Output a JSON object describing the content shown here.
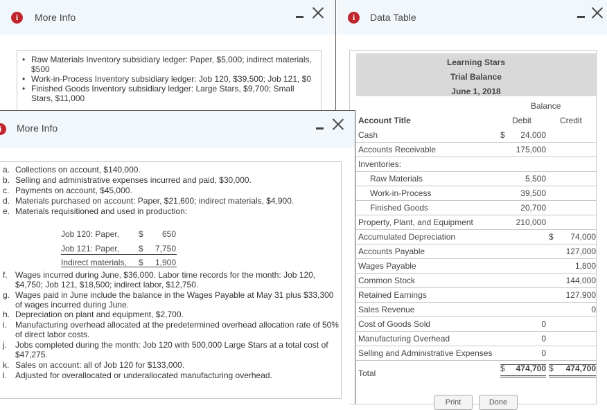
{
  "more_info_1": {
    "title": "More Info",
    "bullets": [
      "Raw Materials Inventory subsidiary ledger: Paper, $5,000; indirect materials, $500",
      "Work-in-Process Inventory subsidiary ledger: Job 120, $39,500; Job 121, $0",
      "Finished Goods Inventory subsidiary ledger: Large Stars, $9,700; Small Stars, $11,000"
    ]
  },
  "more_info_2": {
    "title": "More Info",
    "items": [
      {
        "letter": "a.",
        "text": "Collections on account, $140,000."
      },
      {
        "letter": "b.",
        "text": "Selling and administrative expenses incurred and paid, $30,000."
      },
      {
        "letter": "c.",
        "text": "Payments on account, $45,000."
      },
      {
        "letter": "d.",
        "text": "Materials purchased on account: Paper, $21,600; indirect materials, $4,900."
      },
      {
        "letter": "e.",
        "text": "Materials requisitioned and used in production:"
      },
      {
        "letter": "f.",
        "text": "Wages incurred during June, $36,000. Labor time records for the month: Job 120, $4,750; Job 121, $18,500; indirect labor, $12,750."
      },
      {
        "letter": "g.",
        "text": "Wages paid in June include the balance in the Wages Payable at May 31 plus $33,300 of wages incurred during June."
      },
      {
        "letter": "h.",
        "text": "Depreciation on plant and equipment, $2,700."
      },
      {
        "letter": "i.",
        "text": "Manufacturing overhead allocated at the predetermined overhead allocation rate of 50% of direct labor costs."
      },
      {
        "letter": "j.",
        "text": "Jobs completed during the month: Job 120 with 500,000 Large Stars at a total cost of $47,275."
      },
      {
        "letter": "k.",
        "text": "Sales on account: all of Job 120 for $133,000."
      },
      {
        "letter": "l.",
        "text": "Adjusted for overallocated or underallocated manufacturing overhead."
      }
    ],
    "requisitions": [
      {
        "label": "Job 120: Paper,",
        "dollar": "$",
        "amount": "650"
      },
      {
        "label": "Job 121: Paper,",
        "dollar": "$",
        "amount": "7,750"
      },
      {
        "label": "Indirect materials,",
        "dollar": "$",
        "amount": "1,900"
      }
    ]
  },
  "data_table": {
    "title": "Data Table",
    "company": "Learning Stars",
    "report": "Trial Balance",
    "date": "June 1, 2018",
    "balance_header": "Balance",
    "col_account": "Account Title",
    "col_debit": "Debit",
    "col_credit": "Credit",
    "rows": [
      {
        "account": "Cash",
        "debit_sign": "$",
        "debit": "24,000",
        "credit_sign": "",
        "credit": ""
      },
      {
        "account": "Accounts Receivable",
        "debit_sign": "",
        "debit": "175,000",
        "credit_sign": "",
        "credit": ""
      },
      {
        "account": "Inventories:",
        "debit_sign": "",
        "debit": "",
        "credit_sign": "",
        "credit": ""
      },
      {
        "account": "Raw Materials",
        "indent": true,
        "debit_sign": "",
        "debit": "5,500",
        "credit_sign": "",
        "credit": ""
      },
      {
        "account": "Work-in-Process",
        "indent": true,
        "debit_sign": "",
        "debit": "39,500",
        "credit_sign": "",
        "credit": ""
      },
      {
        "account": "Finished Goods",
        "indent": true,
        "debit_sign": "",
        "debit": "20,700",
        "credit_sign": "",
        "credit": ""
      },
      {
        "account": "Property, Plant, and Equipment",
        "debit_sign": "",
        "debit": "210,000",
        "credit_sign": "",
        "credit": ""
      },
      {
        "account": "Accumulated Depreciation",
        "debit_sign": "",
        "debit": "",
        "credit_sign": "$",
        "credit": "74,000"
      },
      {
        "account": "Accounts Payable",
        "debit_sign": "",
        "debit": "",
        "credit_sign": "",
        "credit": "127,000"
      },
      {
        "account": "Wages Payable",
        "debit_sign": "",
        "debit": "",
        "credit_sign": "",
        "credit": "1,800"
      },
      {
        "account": "Common Stock",
        "debit_sign": "",
        "debit": "",
        "credit_sign": "",
        "credit": "144,000"
      },
      {
        "account": "Retained Earnings",
        "debit_sign": "",
        "debit": "",
        "credit_sign": "",
        "credit": "127,900"
      },
      {
        "account": "Sales Revenue",
        "debit_sign": "",
        "debit": "",
        "credit_sign": "",
        "credit": "0"
      },
      {
        "account": "Cost of Goods Sold",
        "debit_sign": "",
        "debit": "0",
        "credit_sign": "",
        "credit": ""
      },
      {
        "account": "Manufacturing Overhead",
        "debit_sign": "",
        "debit": "0",
        "credit_sign": "",
        "credit": ""
      },
      {
        "account": "Selling and Administrative Expenses",
        "debit_sign": "",
        "debit": "0",
        "credit_sign": "",
        "credit": ""
      }
    ],
    "total": {
      "account": "Total",
      "debit_sign": "$",
      "debit": "474,700",
      "credit_sign": "$",
      "credit": "474,700"
    },
    "print_label": "Print",
    "done_label": "Done"
  }
}
